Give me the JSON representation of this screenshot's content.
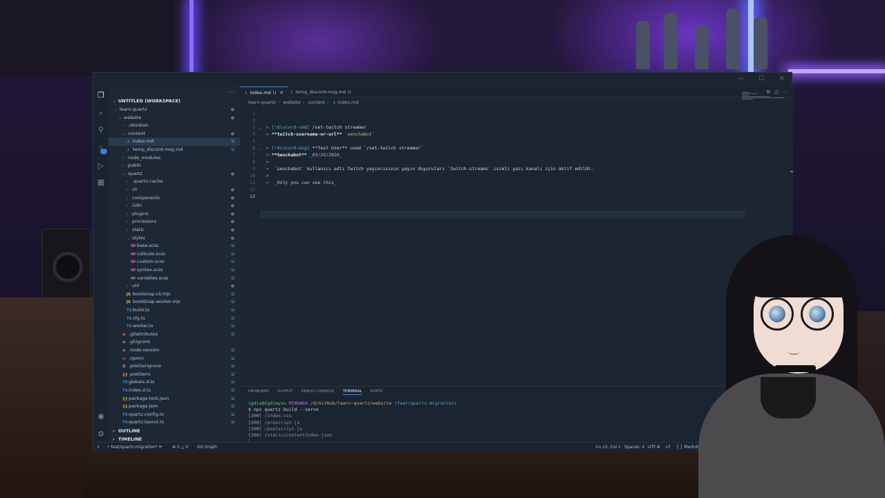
{
  "editor": {
    "tabs": [
      {
        "label": "index.md",
        "status": "U",
        "active": true
      },
      {
        "label": "temp_discord-msg.md",
        "status": "U",
        "active": false
      }
    ],
    "breadcrumb": [
      "learn-quartz",
      "website",
      "content",
      "index.md"
    ],
    "line_numbers": [
      "1",
      "2",
      "3",
      "4",
      "5",
      "6",
      "7",
      "8",
      "9",
      "10",
      "11",
      "12",
      "13"
    ],
    "current_line": 13,
    "lines": [
      {
        "n": 3,
        "prefix": ">",
        "tag": "[!discord-cmd]",
        "text": " /set-twitch streamer"
      },
      {
        "n": 4,
        "prefix": ">",
        "bold": "**twitch-username-or-url**",
        "code": " `senchabot`"
      },
      {
        "n": 6,
        "prefix": ">",
        "tag": "[!discord-msg]",
        "text": " **Test User** used `/set-twitch streamer`"
      },
      {
        "n": 7,
        "prefix": ">",
        "bold": "**Senchabot**",
        "italic": " _03/25/2026_"
      },
      {
        "n": 8,
        "prefix": ">",
        "text": ""
      },
      {
        "n": 9,
        "prefix": ">",
        "text": " `senchabot` kullanıcı adlı Twitch yayıncısının yayın duyuruları `twitch-streams` isimli yazı kanalı için aktif edildi."
      },
      {
        "n": 10,
        "prefix": ">",
        "text": ""
      },
      {
        "n": 11,
        "prefix": ">",
        "italic": " _Only you can see this_"
      }
    ]
  },
  "sidebar": {
    "workspace_title": "UNTITLED (WORKSPACE)",
    "tree": [
      {
        "label": "learn-quartz",
        "type": "folder-open",
        "depth": 0,
        "status": "dot"
      },
      {
        "label": "website",
        "type": "folder-open",
        "depth": 1,
        "status": "dot"
      },
      {
        "label": ".obsidian",
        "type": "folder",
        "depth": 2,
        "status": ""
      },
      {
        "label": "content",
        "type": "folder-open",
        "depth": 2,
        "status": "dot"
      },
      {
        "label": "index.md",
        "type": "md",
        "depth": 3,
        "status": "U",
        "selected": true
      },
      {
        "label": "temp_discord-msg.md",
        "type": "md",
        "depth": 3,
        "status": "U"
      },
      {
        "label": "node_modules",
        "type": "folder",
        "depth": 2,
        "status": ""
      },
      {
        "label": "public",
        "type": "folder",
        "depth": 2,
        "status": ""
      },
      {
        "label": "quartz",
        "type": "folder-open",
        "depth": 2,
        "status": "dot"
      },
      {
        "label": ".quartz-cache",
        "type": "folder",
        "depth": 3,
        "status": ""
      },
      {
        "label": "cli",
        "type": "folder",
        "depth": 3,
        "status": "dot"
      },
      {
        "label": "components",
        "type": "folder",
        "depth": 3,
        "status": "dot"
      },
      {
        "label": "i18n",
        "type": "folder",
        "depth": 3,
        "status": "dot"
      },
      {
        "label": "plugins",
        "type": "folder",
        "depth": 3,
        "status": "dot"
      },
      {
        "label": "processors",
        "type": "folder",
        "depth": 3,
        "status": "dot"
      },
      {
        "label": "static",
        "type": "folder",
        "depth": 3,
        "status": "dot"
      },
      {
        "label": "styles",
        "type": "folder-open",
        "depth": 3,
        "status": "dot"
      },
      {
        "label": "base.scss",
        "type": "scss",
        "depth": 4,
        "status": "U"
      },
      {
        "label": "callouts.scss",
        "type": "scss",
        "depth": 4,
        "status": "U"
      },
      {
        "label": "custom.scss",
        "type": "scss",
        "depth": 4,
        "status": "U"
      },
      {
        "label": "syntax.scss",
        "type": "scss",
        "depth": 4,
        "status": "U"
      },
      {
        "label": "variables.scss",
        "type": "scss",
        "depth": 4,
        "status": "U"
      },
      {
        "label": "util",
        "type": "folder",
        "depth": 3,
        "status": "dot"
      },
      {
        "label": "bootstrap-cli.mjs",
        "type": "js",
        "depth": 3,
        "status": "U"
      },
      {
        "label": "bootstrap-worker.mjs",
        "type": "js",
        "depth": 3,
        "status": "U"
      },
      {
        "label": "build.ts",
        "type": "ts",
        "depth": 3,
        "status": "U"
      },
      {
        "label": "cfg.ts",
        "type": "ts",
        "depth": 3,
        "status": "U"
      },
      {
        "label": "worker.ts",
        "type": "ts",
        "depth": 3,
        "status": "U"
      },
      {
        "label": ".gitattributes",
        "type": "git",
        "depth": 2,
        "status": "U"
      },
      {
        "label": ".gitignore",
        "type": "git",
        "depth": 2,
        "status": ""
      },
      {
        "label": ".node-version",
        "type": "cfg",
        "depth": 2,
        "status": "U"
      },
      {
        "label": ".npmrc",
        "type": "npm",
        "depth": 2,
        "status": "U"
      },
      {
        "label": ".prettierignore",
        "type": "prettier",
        "depth": 2,
        "status": "U"
      },
      {
        "label": ".prettierrc",
        "type": "json",
        "depth": 2,
        "status": "U"
      },
      {
        "label": "globals.d.ts",
        "type": "ts",
        "depth": 2,
        "status": "U"
      },
      {
        "label": "index.d.ts",
        "type": "ts",
        "depth": 2,
        "status": "U"
      },
      {
        "label": "package-lock.json",
        "type": "json",
        "depth": 2,
        "status": "U"
      },
      {
        "label": "package.json",
        "type": "json",
        "depth": 2,
        "status": "U"
      },
      {
        "label": "quartz.config.ts",
        "type": "ts",
        "depth": 2,
        "status": "U"
      },
      {
        "label": "quartz.layout.ts",
        "type": "ts",
        "depth": 2,
        "status": "U"
      }
    ],
    "outline_label": "OUTLINE",
    "timeline_label": "TIMELINE"
  },
  "panel": {
    "tabs": [
      "PROBLEMS",
      "OUTPUT",
      "DEBUG CONSOLE",
      "TERMINAL",
      "PORTS"
    ],
    "active_tab": "TERMINAL",
    "right_label": "ba",
    "prompt": {
      "user": "igdia@Igdiaysu",
      "host": "MINGW64",
      "path": "/d/GitHub/learn-quartz/website",
      "branch": "(feat/quartz-migration)"
    },
    "command": "$ npx quartz build --serve",
    "output": [
      {
        "code": "[200]",
        "path": "/index.css"
      },
      {
        "code": "[200]",
        "path": "/prescript.js"
      },
      {
        "code": "[200]",
        "path": "/postscript.js"
      },
      {
        "code": "[200]",
        "path": "/static/contentIndex.json"
      }
    ]
  },
  "statusbar": {
    "branch": "feat/quartz-migration*",
    "problems": "0",
    "warnings": "0",
    "git_graph": "Git Graph",
    "cursor": "Ln 13, Col 1",
    "spaces": "Spaces: 2",
    "encoding": "UTF-8",
    "eol": "LF",
    "language": "Markdo"
  },
  "colors": {
    "accent": "#3f8cd9",
    "untracked": "#8fb4d8",
    "markdown_icon": "#4fa1e0"
  }
}
